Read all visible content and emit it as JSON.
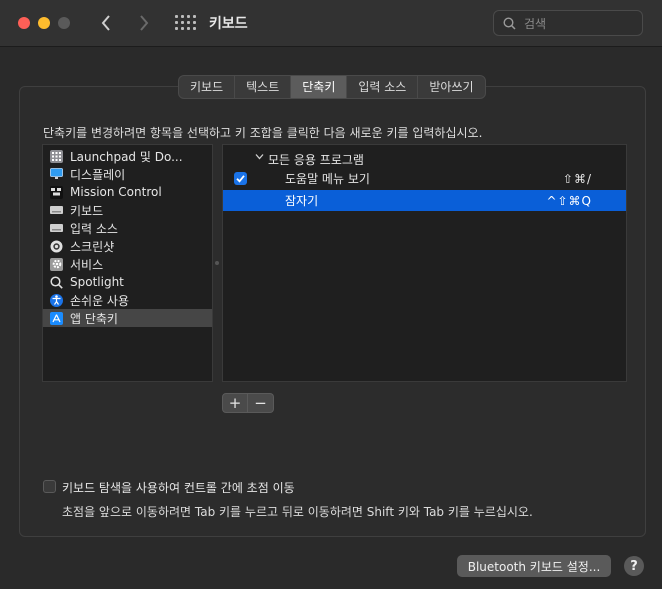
{
  "window": {
    "title": "키보드",
    "search_placeholder": "검색"
  },
  "tabs": [
    {
      "label": "키보드",
      "active": false
    },
    {
      "label": "텍스트",
      "active": false
    },
    {
      "label": "단축키",
      "active": true
    },
    {
      "label": "입력 소스",
      "active": false
    },
    {
      "label": "받아쓰기",
      "active": false
    }
  ],
  "instruction": "단축키를 변경하려면 항목을 선택하고 키 조합을 클릭한 다음 새로운 키를 입력하십시오.",
  "categories": [
    {
      "label": "Launchpad 및 Do...",
      "icon": "launchpad-icon",
      "color": "#8e8e93",
      "selected": false
    },
    {
      "label": "디스플레이",
      "icon": "display-icon",
      "color": "#2f9bf0",
      "selected": false
    },
    {
      "label": "Mission Control",
      "icon": "mission-control-icon",
      "color": "#111111",
      "selected": false
    },
    {
      "label": "키보드",
      "icon": "keyboard-icon",
      "color": "#cfcfcf",
      "selected": false
    },
    {
      "label": "입력 소스",
      "icon": "input-source-icon",
      "color": "#cfcfcf",
      "selected": false
    },
    {
      "label": "스크린샷",
      "icon": "screenshot-icon",
      "color": "#e0e0e0",
      "selected": false
    },
    {
      "label": "서비스",
      "icon": "services-gear-icon",
      "color": "#9a9a9a",
      "selected": false
    },
    {
      "label": "Spotlight",
      "icon": "spotlight-search-icon",
      "color": "#cfcfcf",
      "selected": false
    },
    {
      "label": "손쉬운 사용",
      "icon": "accessibility-icon",
      "color": "#1a73e8",
      "selected": false
    },
    {
      "label": "앱 단축키",
      "icon": "app-store-icon",
      "color": "#1a8cff",
      "selected": true
    }
  ],
  "shortcuts": {
    "group_label": "모든 응용 프로그램",
    "rows": [
      {
        "label": "도움말 메뉴 보기",
        "keys": "⇧⌘/",
        "checked": true,
        "selected": false
      },
      {
        "label": "잠자기",
        "keys": "^⇧⌘Q",
        "checked": false,
        "selected": true
      }
    ]
  },
  "buttons": {
    "add": "+",
    "remove": "−"
  },
  "keyboard_navigation": {
    "label": "키보드 탐색을 사용하여 컨트롤 간에 초점 이동",
    "checked": false,
    "description": "초점을 앞으로 이동하려면 Tab 키를 누르고 뒤로 이동하려면 Shift 키와 Tab 키를 누르십시오."
  },
  "footer": {
    "bluetooth_button": "Bluetooth 키보드 설정...",
    "help_button": "?"
  },
  "colors": {
    "accent": "#0a5fd8",
    "window_bg": "#2a2a2a",
    "list_bg": "#1f1f1f"
  }
}
